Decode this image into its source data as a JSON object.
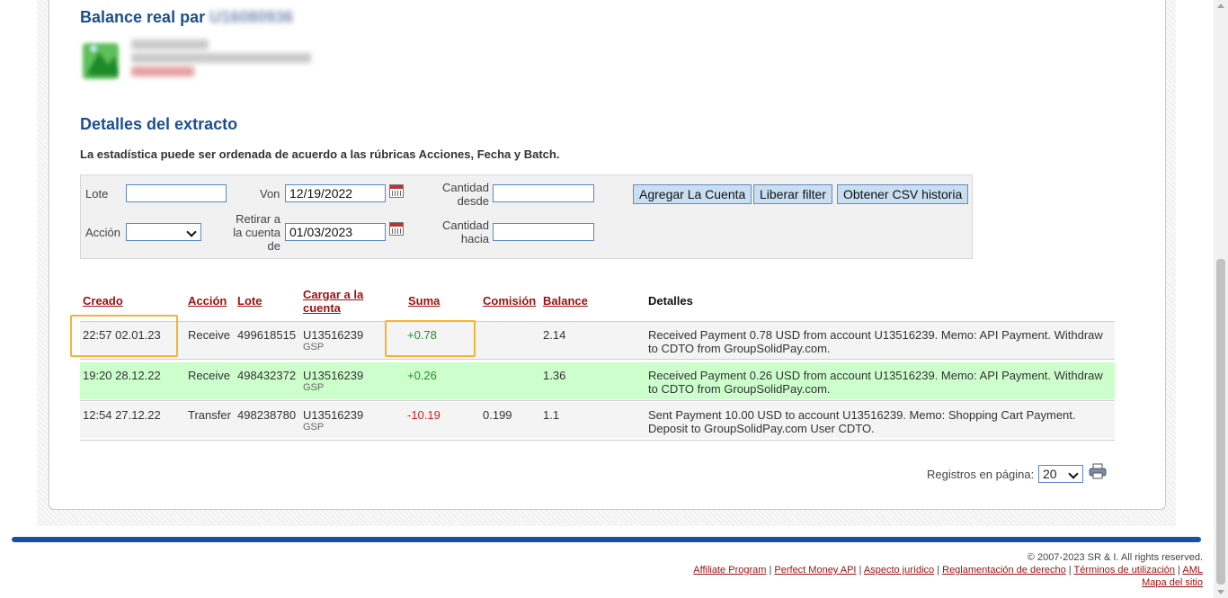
{
  "balance": {
    "title_prefix": "Balance real par",
    "title_blurred": "U16080936"
  },
  "details": {
    "title": "Detalles del extracto",
    "intro": "La estadística puede ser ordenada de acuerdo a las rúbricas Acciones, Fecha y Batch."
  },
  "filters": {
    "lote_label": "Lote",
    "lote_value": "",
    "accion_label": "Acción",
    "accion_value": "",
    "von_label": "Von",
    "von_value": "12/19/2022",
    "retirar_label_1": "Retirar a",
    "retirar_label_2": "la cuenta",
    "retirar_label_3": "de",
    "retirar_value": "01/03/2023",
    "cantidad_desde_1": "Cantidad",
    "cantidad_desde_2": "desde",
    "cantidad_desde_value": "",
    "cantidad_hasta_1": "Cantidad",
    "cantidad_hasta_2": "hacia",
    "cantidad_hasta_value": "",
    "btn_add": "Agregar La Cuenta",
    "btn_clear": "Liberar filter",
    "btn_csv": "Obtener CSV historia"
  },
  "table": {
    "headers": {
      "creado": "Creado",
      "accion": "Acción",
      "lote": "Lote",
      "cargar_1": "Cargar a la",
      "cargar_2": "cuenta",
      "suma": "Suma",
      "comision": "Comisión",
      "balance": "Balance",
      "detalles": "Detalles"
    },
    "rows": [
      {
        "creado": "22:57 02.01.23",
        "accion": "Receive",
        "lote": "499618515",
        "cuenta": "U13516239",
        "cuenta_sub": "GSP",
        "suma": "+0.78",
        "comision": "",
        "balance": "2.14",
        "detalles_1": "Received Payment 0.78 USD from account U13516239. Memo: API Payment. Withdraw",
        "detalles_2": "to CDTO from GroupSolidPay.com."
      },
      {
        "creado": "19:20 28.12.22",
        "accion": "Receive",
        "lote": "498432372",
        "cuenta": "U13516239",
        "cuenta_sub": "GSP",
        "suma": "+0.26",
        "comision": "",
        "balance": "1.36",
        "detalles_1": "Received Payment 0.26 USD from account U13516239. Memo: API Payment. Withdraw",
        "detalles_2": "to CDTO from GroupSolidPay.com."
      },
      {
        "creado": "12:54 27.12.22",
        "accion": "Transfer",
        "lote": "498238780",
        "cuenta": "U13516239",
        "cuenta_sub": "GSP",
        "suma": "-10.19",
        "comision": "0.199",
        "balance": "1.1",
        "detalles_1": "Sent Payment 10.00 USD to account U13516239. Memo: Shopping Cart Payment.",
        "detalles_2": "Deposit to GroupSolidPay.com User CDTO."
      }
    ]
  },
  "pager": {
    "label": "Registros en página:",
    "value": "20"
  },
  "footer": {
    "copyright": "© 2007-2023 SR & I. All rights reserved.",
    "links": [
      "Affiliate Program",
      "Perfect Money API",
      "Aspecto jurídico",
      "Reglamentación de derecho",
      "Términos de utilización",
      "AML",
      "Mapa del sitio"
    ]
  },
  "colors": {
    "accent": "#1c4f8f",
    "link": "#9b1010",
    "row_highlight": "#ccffcc",
    "positive": "#2a8a2a",
    "negative": "#d42020",
    "callout": "#f5b332"
  }
}
